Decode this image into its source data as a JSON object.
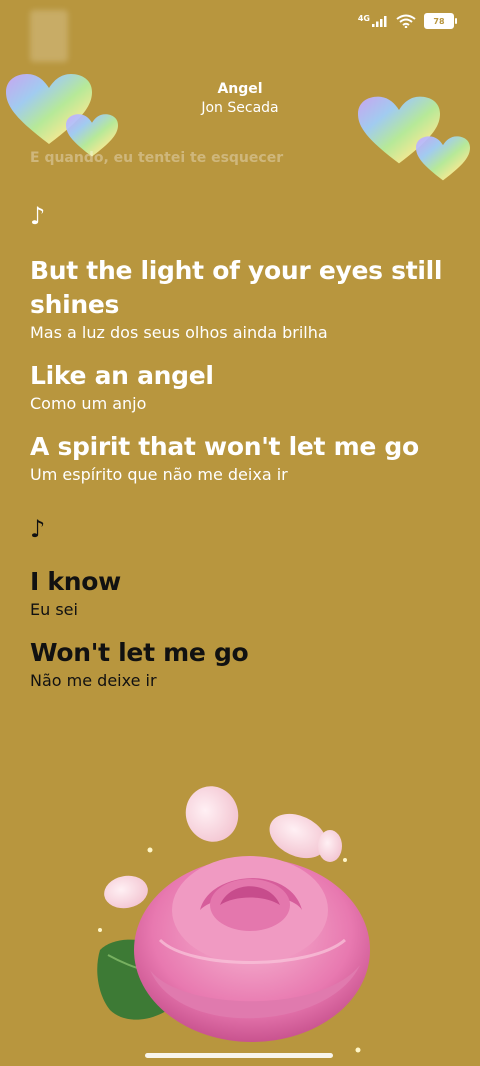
{
  "status_bar": {
    "network": "4G",
    "battery": "78"
  },
  "header": {
    "title": "Angel",
    "artist": "Jon Secada"
  },
  "faded_line": "E quando, eu tentei te esquecer",
  "note_symbol": "♪",
  "lyrics": [
    {
      "main": "But the light of your eyes still shines",
      "translation": "Mas a luz dos seus olhos ainda brilha"
    },
    {
      "main": "Like an angel",
      "translation": "Como um anjo"
    },
    {
      "main": "A spirit that won't let me go",
      "translation": "Um espírito que não me deixa ir"
    },
    {
      "main": "I know",
      "translation": "Eu sei"
    },
    {
      "main": "Won't let me go",
      "translation": "Não me deixe ir"
    }
  ],
  "colors": {
    "background": "#b8963e",
    "active_text": "#111111",
    "inactive_text": "#ffffff"
  }
}
